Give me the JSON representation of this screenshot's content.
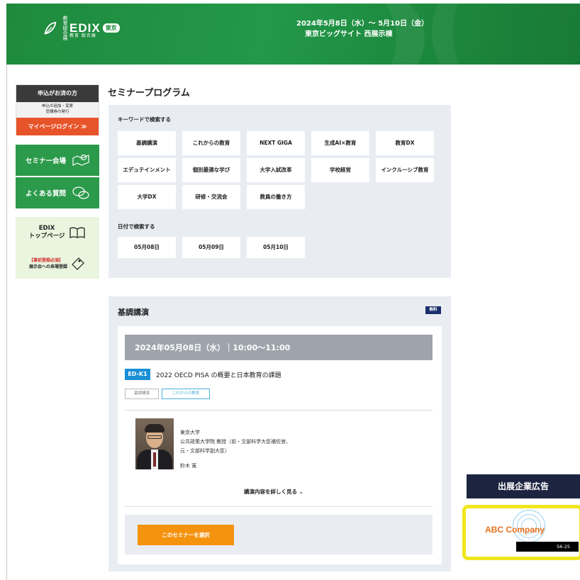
{
  "colors": {
    "header_green": "#1f8a3c",
    "accent_orange": "#f5920e",
    "mypage_orange": "#e8542a",
    "code_blue": "#1a8fd6",
    "navy": "#1c2440",
    "ad_yellow": "#f0e61e"
  },
  "header": {
    "logo_small": "教育総合展",
    "logo_brand": "EDIX",
    "logo_pill": "東京",
    "logo_sub": "教育 総合展",
    "dates": "2024年5月8日（水）～ 5月10日（金）",
    "venue": "東京ビッグサイト 西展示棟"
  },
  "sidebar": {
    "apply_title": "申込がお済の方",
    "apply_note_1": "申込の追加・変更",
    "apply_note_2": "受講券の発行",
    "mypage_login": "マイページログイン ≫",
    "seminar_venue": "セミナー会場",
    "faq": "よくある質問",
    "top_line1": "EDIX",
    "top_line2": "トップページ",
    "reg_line1": "【事前登録必須】",
    "reg_line2": "展示会への来場登録"
  },
  "main": {
    "title": "セミナープログラム",
    "keyword_label": "キーワードで検索する",
    "keywords": [
      "基調講演",
      "これからの教育",
      "NEXT GIGA",
      "生成AI×教育",
      "教育DX",
      "エデュテインメント",
      "個別最適な学び",
      "大学入試改革",
      "学校経営",
      "インクルーシブ教育",
      "大学DX",
      "研修・交流会",
      "教員の働き方"
    ],
    "date_label": "日付で検索する",
    "dates": [
      "05月08日",
      "05月09日",
      "05月10日"
    ]
  },
  "lecture": {
    "section_title": "基調講演",
    "free_badge": "無料",
    "datetime": "2024年05月08日（水）｜10:00～11:00",
    "code": "ED-K1",
    "seminar_title": "2022 OECD PISA の概要と日本教育の課題",
    "tags": [
      "基調講演",
      "これからの教育"
    ],
    "speaker_org": "東京大学",
    "speaker_title1": "公共政策大学院 教授（前・文部科学大臣補佐官、",
    "speaker_title2": "元・文部科学副大臣）",
    "speaker_name": "鈴木 寛",
    "detail_link": "講演内容を詳しく見る ⌄",
    "select_button": "このセミナーを選択"
  },
  "ads": {
    "heading": "出展企業広告",
    "company": "ABC Company",
    "booth": "S6-25"
  }
}
